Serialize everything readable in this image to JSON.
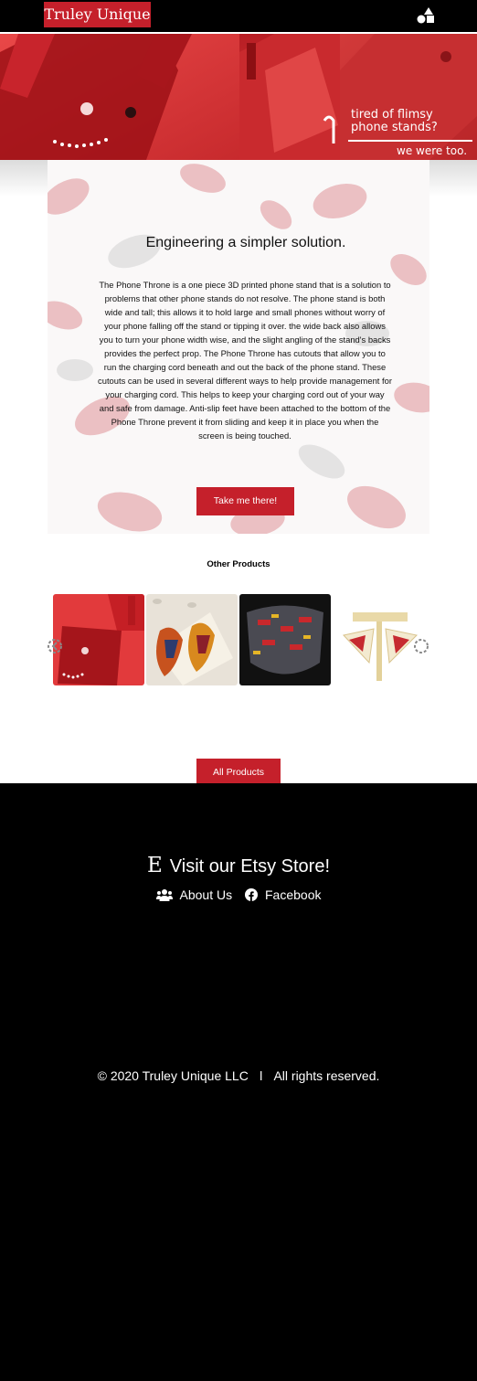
{
  "header": {
    "brand": "Truley Unique",
    "menu_icon": "shapes-icon"
  },
  "banner": {
    "line1": "tired of flimsy phone stands?",
    "line2": "we were too."
  },
  "intro": {
    "title": "Engineering a simpler solution.",
    "body": "The Phone Throne is a one piece 3D printed phone stand that is a solution to problems that other phone stands do not resolve. The phone stand is both wide and tall; this allows it to hold large and small phones without worry of your phone falling off the stand or tipping it over. the wide back also allows you to turn your phone width wise, and the slight angling of the stand's backs provides the perfect prop. The Phone Throne has cutouts that allow you to run the charging cord beneath and out the back of the phone stand. These cutouts can be used in several different ways to help provide management for your charging cord. This helps to keep your charging cord out of your way and safe from damage. Anti-slip feet have been attached to the bottom of the Phone Throne prevent it from sliding and keep it in place you when the screen is being touched.",
    "button": "Take me there!"
  },
  "products": {
    "title": "Other Products",
    "items": [
      "red-phone-stand",
      "patterned-earrings",
      "patterned-face-mask",
      "arrowhead-earrings"
    ],
    "all_button": "All Products"
  },
  "footer": {
    "etsy_icon_letter": "E",
    "etsy_label": "Visit our Etsy Store!",
    "about_label": "About Us",
    "facebook_label": "Facebook",
    "copyright": "© 2020 Truley Unique LLC",
    "separator": "ǀ",
    "rights": "All rights reserved."
  },
  "colors": {
    "accent": "#c5202b",
    "header_bg": "#000000",
    "footer_bg": "#000000"
  }
}
